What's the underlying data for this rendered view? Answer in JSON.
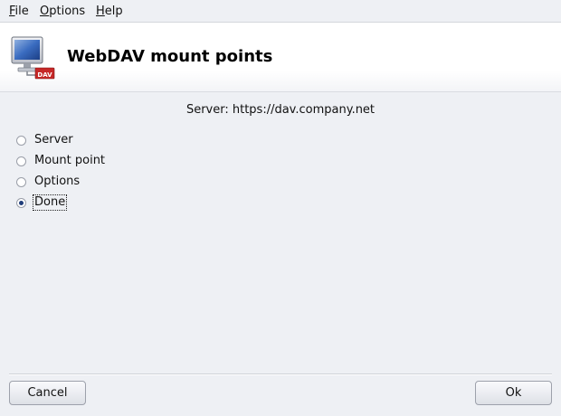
{
  "menubar": {
    "file": {
      "mnemonic": "F",
      "rest": "ile"
    },
    "options": {
      "mnemonic": "O",
      "rest": "ptions"
    },
    "help": {
      "mnemonic": "H",
      "rest": "elp"
    }
  },
  "banner": {
    "title": "WebDAV mount points",
    "icon": "webdav-monitor-icon",
    "icon_badge_text": "DAV"
  },
  "server_label": "Server: https://dav.company.net",
  "options": [
    {
      "label": "Server",
      "selected": false
    },
    {
      "label": "Mount point",
      "selected": false
    },
    {
      "label": "Options",
      "selected": false
    },
    {
      "label": "Done",
      "selected": true,
      "focused": true
    }
  ],
  "buttons": {
    "cancel": "Cancel",
    "ok": "Ok"
  },
  "colors": {
    "background": "#eef0f4",
    "radio_dot": "#1f3d7a",
    "badge": "#c62828"
  }
}
